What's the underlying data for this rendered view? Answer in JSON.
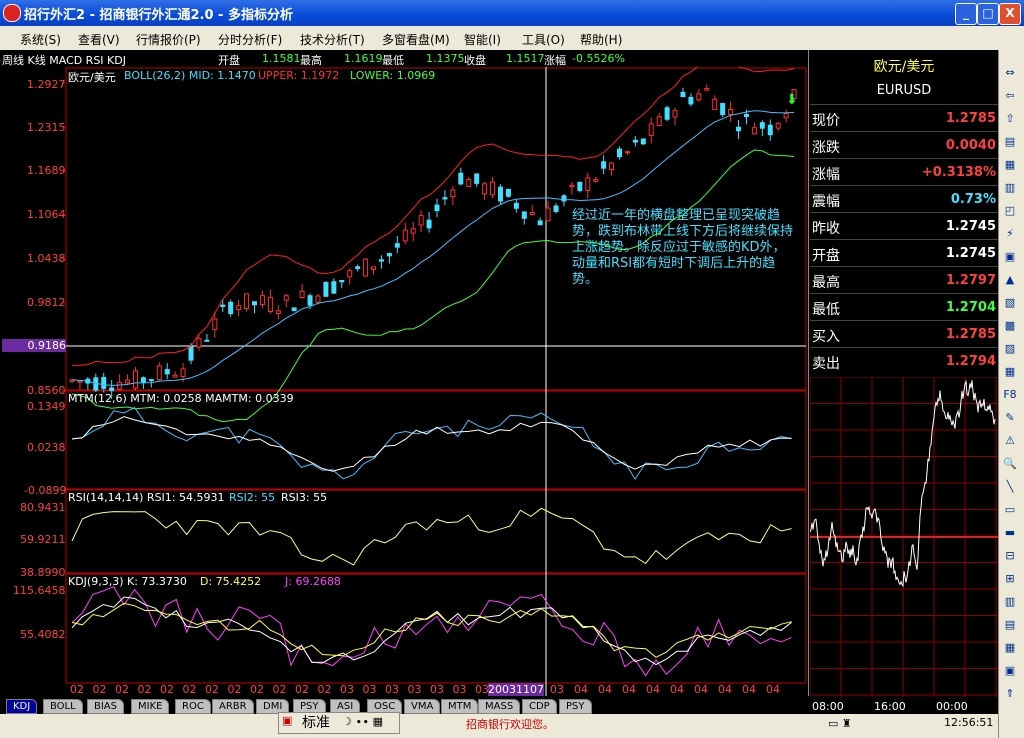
{
  "window": {
    "title": "招行外汇2 - 招商银行外汇通2.0 - 多指标分析",
    "min": "_",
    "max": "□",
    "close": "X"
  },
  "menu": [
    "系统(S)",
    "查看(V)",
    "行情报价(P)",
    "分时分析(F)",
    "技术分析(T)",
    "多窗看盘(M)",
    "智能(I)",
    "工具(O)",
    "帮助(H)"
  ],
  "info": {
    "panel_label": "周线 K线 MACD RSI KDJ",
    "open_label": "开盘",
    "open": "1.1581",
    "high_label": "最高",
    "high": "1.1619",
    "low_label": "最低",
    "low": "1.1375",
    "close_label": "收盘",
    "close": "1.1517",
    "chg_label": "涨幅",
    "chg": "-0.5526%"
  },
  "main": {
    "title": "欧元/美元",
    "boll": "BOLL(26,2) MID: 1.1470",
    "upper": "UPPER: 1.1972",
    "lower": "LOWER: 1.0969",
    "yticks": [
      "1.2927",
      "1.2315",
      "1.1689",
      "1.1064",
      "1.0438",
      "0.9812",
      "0.9186",
      "0.8560"
    ],
    "annotation": "经过近一年的横盘整理已呈现突破趋势，跌到布林带上线下方后将继续保持上涨趋势。除反应过于敏感的KD外，动量和RSI都有短时下调后上升的趋势。"
  },
  "mtm": {
    "label": "MTM(12,6) MTM: 0.0258 MAMTM: 0.0339",
    "yticks": [
      "0.1349",
      "0.0238",
      "-0.0899"
    ]
  },
  "rsi": {
    "label1": "RSI(14,14,14) RSI1: 54.5931",
    "label2": "RSI2: 55",
    "label3": "RSI3: 55",
    "yticks": [
      "80.9431",
      "59.9211",
      "38.8990"
    ]
  },
  "kdj": {
    "label1": "KDJ(9,3,3) K: 73.3730",
    "label2": "D: 75.4252",
    "label3": "J: 69.2688",
    "yticks": [
      "115.6458",
      "55.4082"
    ]
  },
  "xaxis": {
    "labels": [
      "02",
      "02",
      "02",
      "02",
      "02",
      "02",
      "02",
      "02",
      "02",
      "02",
      "02",
      "02",
      "03",
      "03",
      "03",
      "03",
      "03",
      "03",
      "03"
    ],
    "cursor": "20031107",
    "labels2": [
      "03",
      "04",
      "04",
      "04",
      "04",
      "04",
      "04",
      "04",
      "04",
      "04"
    ]
  },
  "quote": {
    "name": "欧元/美元",
    "code": "EURUSD",
    "rows": [
      {
        "label": "现价",
        "value": "1.2785",
        "color": "#ff4040"
      },
      {
        "label": "涨跌",
        "value": "0.0040",
        "color": "#ff4040"
      },
      {
        "label": "涨幅",
        "value": "+0.3138%",
        "color": "#ff4040"
      },
      {
        "label": "震幅",
        "value": "0.73%",
        "color": "#40e0ff"
      },
      {
        "label": "昨收",
        "value": "1.2745",
        "color": "#ffffff"
      },
      {
        "label": "开盘",
        "value": "1.2745",
        "color": "#ffffff"
      },
      {
        "label": "最高",
        "value": "1.2797",
        "color": "#ff4040"
      },
      {
        "label": "最低",
        "value": "1.2704",
        "color": "#40ff40"
      },
      {
        "label": "买入",
        "value": "1.2785",
        "color": "#ff4040"
      },
      {
        "label": "卖出",
        "value": "1.2794",
        "color": "#ff4040"
      }
    ],
    "times": [
      "08:00",
      "16:00",
      "00:00"
    ]
  },
  "tabs": [
    "KDJ",
    "BOLL",
    "BIAS",
    "MIKE",
    "ROC",
    "ARBR",
    "DMI",
    "PSY",
    "ASI",
    "OSC",
    "VMA",
    "MTM",
    "MASS",
    "CDP",
    "PSY"
  ],
  "status": {
    "ime": "标准",
    "ime2": "☽ ∙∙ ▦",
    "marquee": "招商银行欢迎您。",
    "clock": "12:56:51"
  }
}
